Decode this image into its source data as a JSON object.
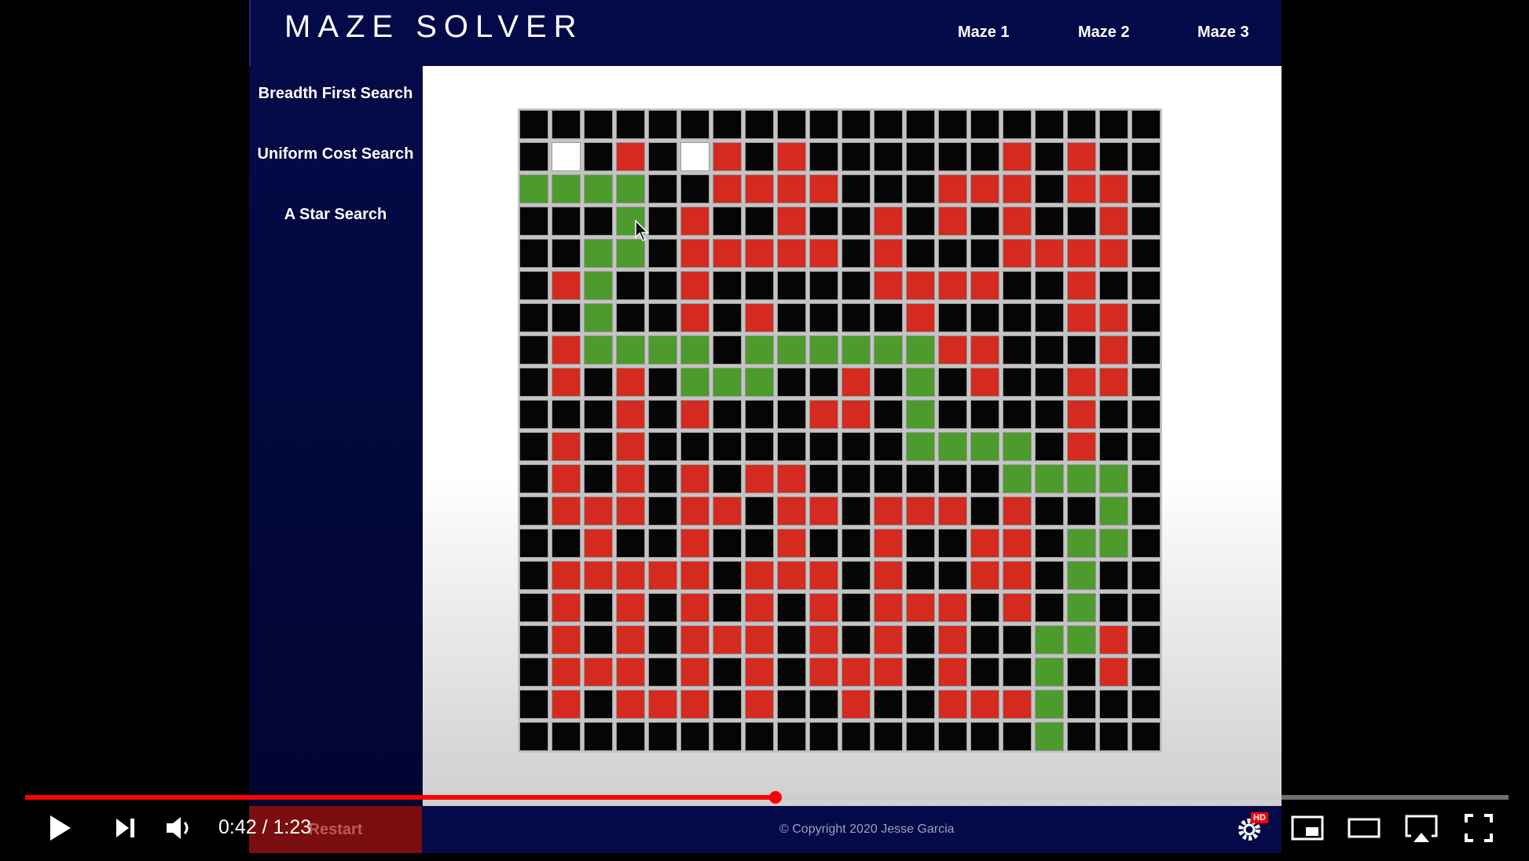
{
  "app": {
    "title": "MAZE SOLVER",
    "nav": [
      "Maze 1",
      "Maze 2",
      "Maze 3"
    ],
    "sidebar": [
      "Breadth First Search",
      "Uniform Cost Search",
      "A Star Search"
    ],
    "restart_label": "Restart",
    "copyright": "© Copyright 2020 Jesse Garcia"
  },
  "maze": {
    "legend": {
      "B": "#050505",
      "R": "#d42a1f",
      "G": "#4c9b2c",
      "W": "#ffffff"
    },
    "rows": [
      "BBBBBBBBBBBBBBBBBBBB",
      "BWBRBWRBRBBBBBBRBRBB",
      "GGGGBBRRRRBBBRRRBRRB",
      "BBBGBRBBRBBRBRBRBBRB",
      "BBGGBRRRRRBRBBBRRRRB",
      "BRGBBRBBBBBRRRRBBRBB",
      "BBGBBRBRBBBBRBBBBRRB",
      "BRGGGGBGGGGGGRRBBBRB",
      "BRBRBGGGBBRBGBRBBRRB",
      "BBBRBRBBBRRBGBBBBRBB",
      "BRBRBBBBBBBBGGGGBRBB",
      "BRBRBRBRRBBBBBBGGGGB",
      "BRRRBRRBRRBRRRBRBBGB",
      "BBRBBRBBRBBRBBRRBGGB",
      "BRRRRRBRRRBRBBRRBGBB",
      "BRBRBRBRBRBRRRBRBGBB",
      "BRBRBRRRBRBRBRBBGGRB",
      "BRRRBRBRBRRRBRBBGBRB",
      "BRBRRRBRBBRBBRRRGBBB",
      "BBBBBBBBBBBBBBBBGBBB"
    ]
  },
  "player": {
    "time": "0:42 / 1:23",
    "progress": 0.506,
    "icons": [
      "play-icon",
      "next-icon",
      "volume-icon",
      "settings-icon",
      "miniplayer-icon",
      "theater-icon",
      "airplay-icon",
      "fullscreen-icon"
    ],
    "hd_badge": "HD",
    "accent": "#ff0000"
  }
}
